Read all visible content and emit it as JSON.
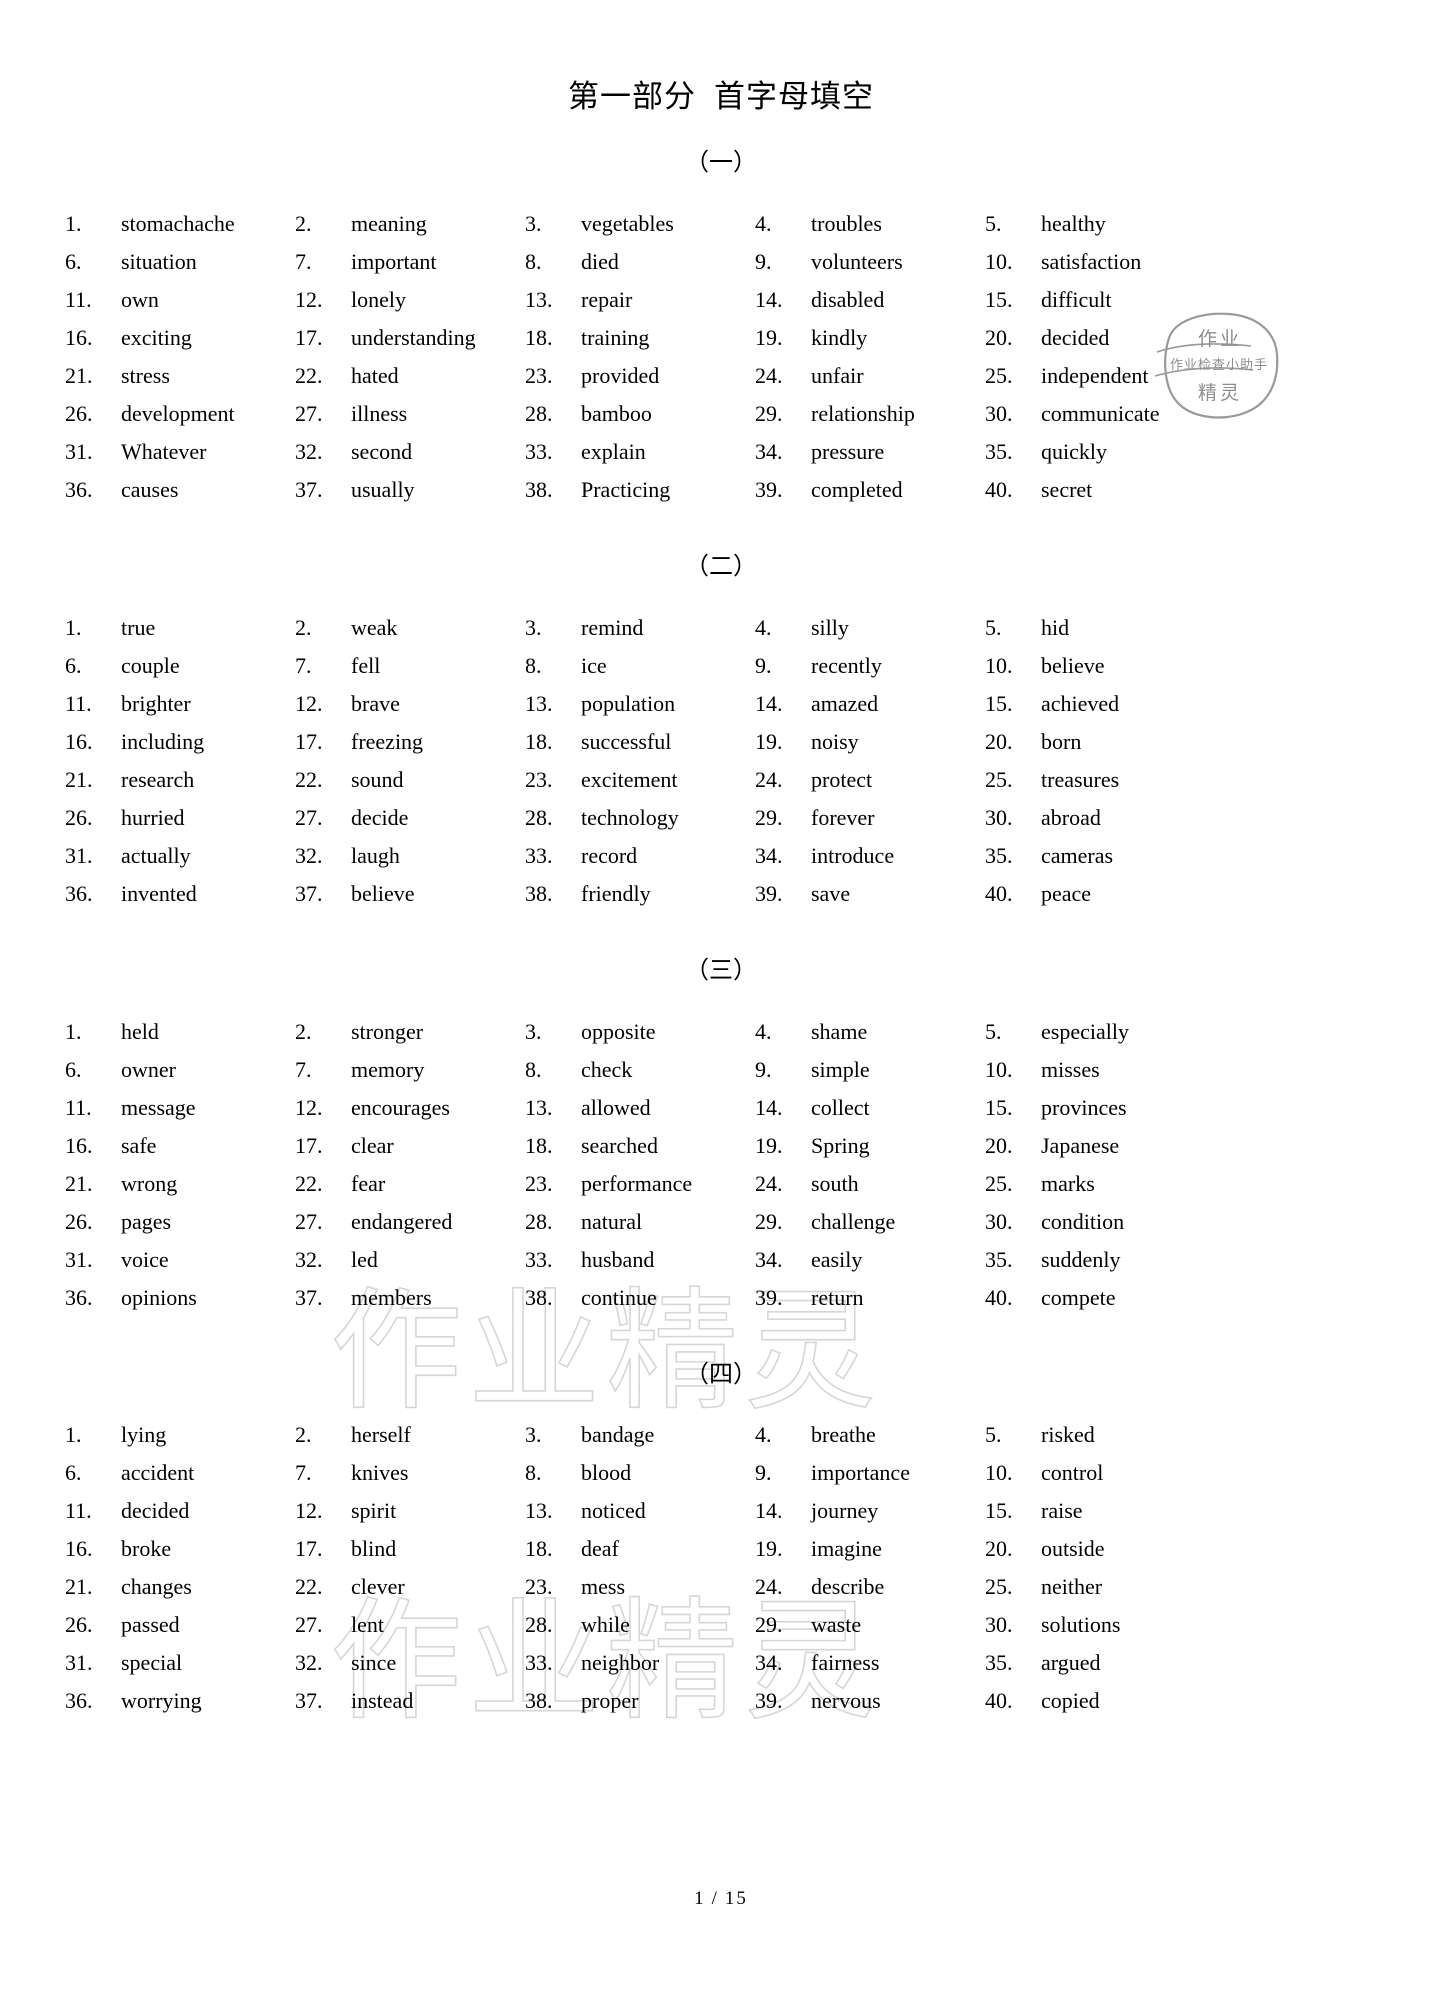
{
  "document": {
    "title_main": "第一部分",
    "title_sub": "首字母填空",
    "footer_page": "1",
    "footer_separator": "/",
    "footer_total": "15"
  },
  "watermark": {
    "stamp_top": "作业",
    "stamp_middle": "作业检查小助手",
    "stamp_bottom": "精灵",
    "background_text": "作业精灵"
  },
  "sections": [
    {
      "heading": "（一）",
      "words": [
        {
          "num": "1.",
          "word": "stomachache"
        },
        {
          "num": "2.",
          "word": "meaning"
        },
        {
          "num": "3.",
          "word": "vegetables"
        },
        {
          "num": "4.",
          "word": "troubles"
        },
        {
          "num": "5.",
          "word": "healthy"
        },
        {
          "num": "6.",
          "word": "situation"
        },
        {
          "num": "7.",
          "word": "important"
        },
        {
          "num": "8.",
          "word": "died"
        },
        {
          "num": "9.",
          "word": "volunteers"
        },
        {
          "num": "10.",
          "word": "satisfaction"
        },
        {
          "num": "11.",
          "word": "own"
        },
        {
          "num": "12.",
          "word": "lonely"
        },
        {
          "num": "13.",
          "word": "repair"
        },
        {
          "num": "14.",
          "word": "disabled"
        },
        {
          "num": "15.",
          "word": "difficult"
        },
        {
          "num": "16.",
          "word": "exciting"
        },
        {
          "num": "17.",
          "word": "understanding"
        },
        {
          "num": "18.",
          "word": "training"
        },
        {
          "num": "19.",
          "word": "kindly"
        },
        {
          "num": "20.",
          "word": "decided"
        },
        {
          "num": "21.",
          "word": "stress"
        },
        {
          "num": "22.",
          "word": "hated"
        },
        {
          "num": "23.",
          "word": "provided"
        },
        {
          "num": "24.",
          "word": "unfair"
        },
        {
          "num": "25.",
          "word": "independent"
        },
        {
          "num": "26.",
          "word": "development"
        },
        {
          "num": "27.",
          "word": "illness"
        },
        {
          "num": "28.",
          "word": "bamboo"
        },
        {
          "num": "29.",
          "word": "relationship"
        },
        {
          "num": "30.",
          "word": "communicate"
        },
        {
          "num": "31.",
          "word": "Whatever"
        },
        {
          "num": "32.",
          "word": "second"
        },
        {
          "num": "33.",
          "word": "explain"
        },
        {
          "num": "34.",
          "word": "pressure"
        },
        {
          "num": "35.",
          "word": "quickly"
        },
        {
          "num": "36.",
          "word": "causes"
        },
        {
          "num": "37.",
          "word": "usually"
        },
        {
          "num": "38.",
          "word": "Practicing"
        },
        {
          "num": "39.",
          "word": "completed"
        },
        {
          "num": "40.",
          "word": "secret"
        }
      ]
    },
    {
      "heading": "（二）",
      "words": [
        {
          "num": "1.",
          "word": "true"
        },
        {
          "num": "2.",
          "word": "weak"
        },
        {
          "num": "3.",
          "word": "remind"
        },
        {
          "num": "4.",
          "word": "silly"
        },
        {
          "num": "5.",
          "word": "hid"
        },
        {
          "num": "6.",
          "word": "couple"
        },
        {
          "num": "7.",
          "word": "fell"
        },
        {
          "num": "8.",
          "word": "ice"
        },
        {
          "num": "9.",
          "word": "recently"
        },
        {
          "num": "10.",
          "word": "believe"
        },
        {
          "num": "11.",
          "word": "brighter"
        },
        {
          "num": "12.",
          "word": "brave"
        },
        {
          "num": "13.",
          "word": "population"
        },
        {
          "num": "14.",
          "word": "amazed"
        },
        {
          "num": "15.",
          "word": "achieved"
        },
        {
          "num": "16.",
          "word": "including"
        },
        {
          "num": "17.",
          "word": "freezing"
        },
        {
          "num": "18.",
          "word": "successful"
        },
        {
          "num": "19.",
          "word": "noisy"
        },
        {
          "num": "20.",
          "word": "born"
        },
        {
          "num": "21.",
          "word": "research"
        },
        {
          "num": "22.",
          "word": "sound"
        },
        {
          "num": "23.",
          "word": "excitement"
        },
        {
          "num": "24.",
          "word": "protect"
        },
        {
          "num": "25.",
          "word": "treasures"
        },
        {
          "num": "26.",
          "word": "hurried"
        },
        {
          "num": "27.",
          "word": "decide"
        },
        {
          "num": "28.",
          "word": "technology"
        },
        {
          "num": "29.",
          "word": "forever"
        },
        {
          "num": "30.",
          "word": "abroad"
        },
        {
          "num": "31.",
          "word": "actually"
        },
        {
          "num": "32.",
          "word": "laugh"
        },
        {
          "num": "33.",
          "word": "record"
        },
        {
          "num": "34.",
          "word": "introduce"
        },
        {
          "num": "35.",
          "word": "cameras"
        },
        {
          "num": "36.",
          "word": "invented"
        },
        {
          "num": "37.",
          "word": "believe"
        },
        {
          "num": "38.",
          "word": "friendly"
        },
        {
          "num": "39.",
          "word": "save"
        },
        {
          "num": "40.",
          "word": "peace"
        }
      ]
    },
    {
      "heading": "（三）",
      "words": [
        {
          "num": "1.",
          "word": "held"
        },
        {
          "num": "2.",
          "word": "stronger"
        },
        {
          "num": "3.",
          "word": "opposite"
        },
        {
          "num": "4.",
          "word": "shame"
        },
        {
          "num": "5.",
          "word": "especially"
        },
        {
          "num": "6.",
          "word": "owner"
        },
        {
          "num": "7.",
          "word": "memory"
        },
        {
          "num": "8.",
          "word": "check"
        },
        {
          "num": "9.",
          "word": "simple"
        },
        {
          "num": "10.",
          "word": "misses"
        },
        {
          "num": "11.",
          "word": "message"
        },
        {
          "num": "12.",
          "word": "encourages"
        },
        {
          "num": "13.",
          "word": "allowed"
        },
        {
          "num": "14.",
          "word": "collect"
        },
        {
          "num": "15.",
          "word": "provinces"
        },
        {
          "num": "16.",
          "word": "safe"
        },
        {
          "num": "17.",
          "word": "clear"
        },
        {
          "num": "18.",
          "word": "searched"
        },
        {
          "num": "19.",
          "word": "Spring"
        },
        {
          "num": "20.",
          "word": "Japanese"
        },
        {
          "num": "21.",
          "word": "wrong"
        },
        {
          "num": "22.",
          "word": "fear"
        },
        {
          "num": "23.",
          "word": "performance"
        },
        {
          "num": "24.",
          "word": "south"
        },
        {
          "num": "25.",
          "word": "marks"
        },
        {
          "num": "26.",
          "word": "pages"
        },
        {
          "num": "27.",
          "word": "endangered"
        },
        {
          "num": "28.",
          "word": "natural"
        },
        {
          "num": "29.",
          "word": "challenge"
        },
        {
          "num": "30.",
          "word": "condition"
        },
        {
          "num": "31.",
          "word": "voice"
        },
        {
          "num": "32.",
          "word": "led"
        },
        {
          "num": "33.",
          "word": "husband"
        },
        {
          "num": "34.",
          "word": "easily"
        },
        {
          "num": "35.",
          "word": "suddenly"
        },
        {
          "num": "36.",
          "word": "opinions"
        },
        {
          "num": "37.",
          "word": "members"
        },
        {
          "num": "38.",
          "word": "continue"
        },
        {
          "num": "39.",
          "word": "return"
        },
        {
          "num": "40.",
          "word": "compete"
        }
      ]
    },
    {
      "heading": "（四）",
      "words": [
        {
          "num": "1.",
          "word": "lying"
        },
        {
          "num": "2.",
          "word": "herself"
        },
        {
          "num": "3.",
          "word": "bandage"
        },
        {
          "num": "4.",
          "word": "breathe"
        },
        {
          "num": "5.",
          "word": "risked"
        },
        {
          "num": "6.",
          "word": "accident"
        },
        {
          "num": "7.",
          "word": "knives"
        },
        {
          "num": "8.",
          "word": "blood"
        },
        {
          "num": "9.",
          "word": "importance"
        },
        {
          "num": "10.",
          "word": "control"
        },
        {
          "num": "11.",
          "word": "decided"
        },
        {
          "num": "12.",
          "word": "spirit"
        },
        {
          "num": "13.",
          "word": "noticed"
        },
        {
          "num": "14.",
          "word": "journey"
        },
        {
          "num": "15.",
          "word": "raise"
        },
        {
          "num": "16.",
          "word": "broke"
        },
        {
          "num": "17.",
          "word": "blind"
        },
        {
          "num": "18.",
          "word": "deaf"
        },
        {
          "num": "19.",
          "word": "imagine"
        },
        {
          "num": "20.",
          "word": "outside"
        },
        {
          "num": "21.",
          "word": "changes"
        },
        {
          "num": "22.",
          "word": "clever"
        },
        {
          "num": "23.",
          "word": "mess"
        },
        {
          "num": "24.",
          "word": "describe"
        },
        {
          "num": "25.",
          "word": "neither"
        },
        {
          "num": "26.",
          "word": "passed"
        },
        {
          "num": "27.",
          "word": "lent"
        },
        {
          "num": "28.",
          "word": "while"
        },
        {
          "num": "29.",
          "word": "waste"
        },
        {
          "num": "30.",
          "word": "solutions"
        },
        {
          "num": "31.",
          "word": "special"
        },
        {
          "num": "32.",
          "word": "since"
        },
        {
          "num": "33.",
          "word": "neighbor"
        },
        {
          "num": "34.",
          "word": "fairness"
        },
        {
          "num": "35.",
          "word": "argued"
        },
        {
          "num": "36.",
          "word": "worrying"
        },
        {
          "num": "37.",
          "word": "instead"
        },
        {
          "num": "38.",
          "word": "proper"
        },
        {
          "num": "39.",
          "word": "nervous"
        },
        {
          "num": "40.",
          "word": "copied"
        }
      ]
    }
  ]
}
